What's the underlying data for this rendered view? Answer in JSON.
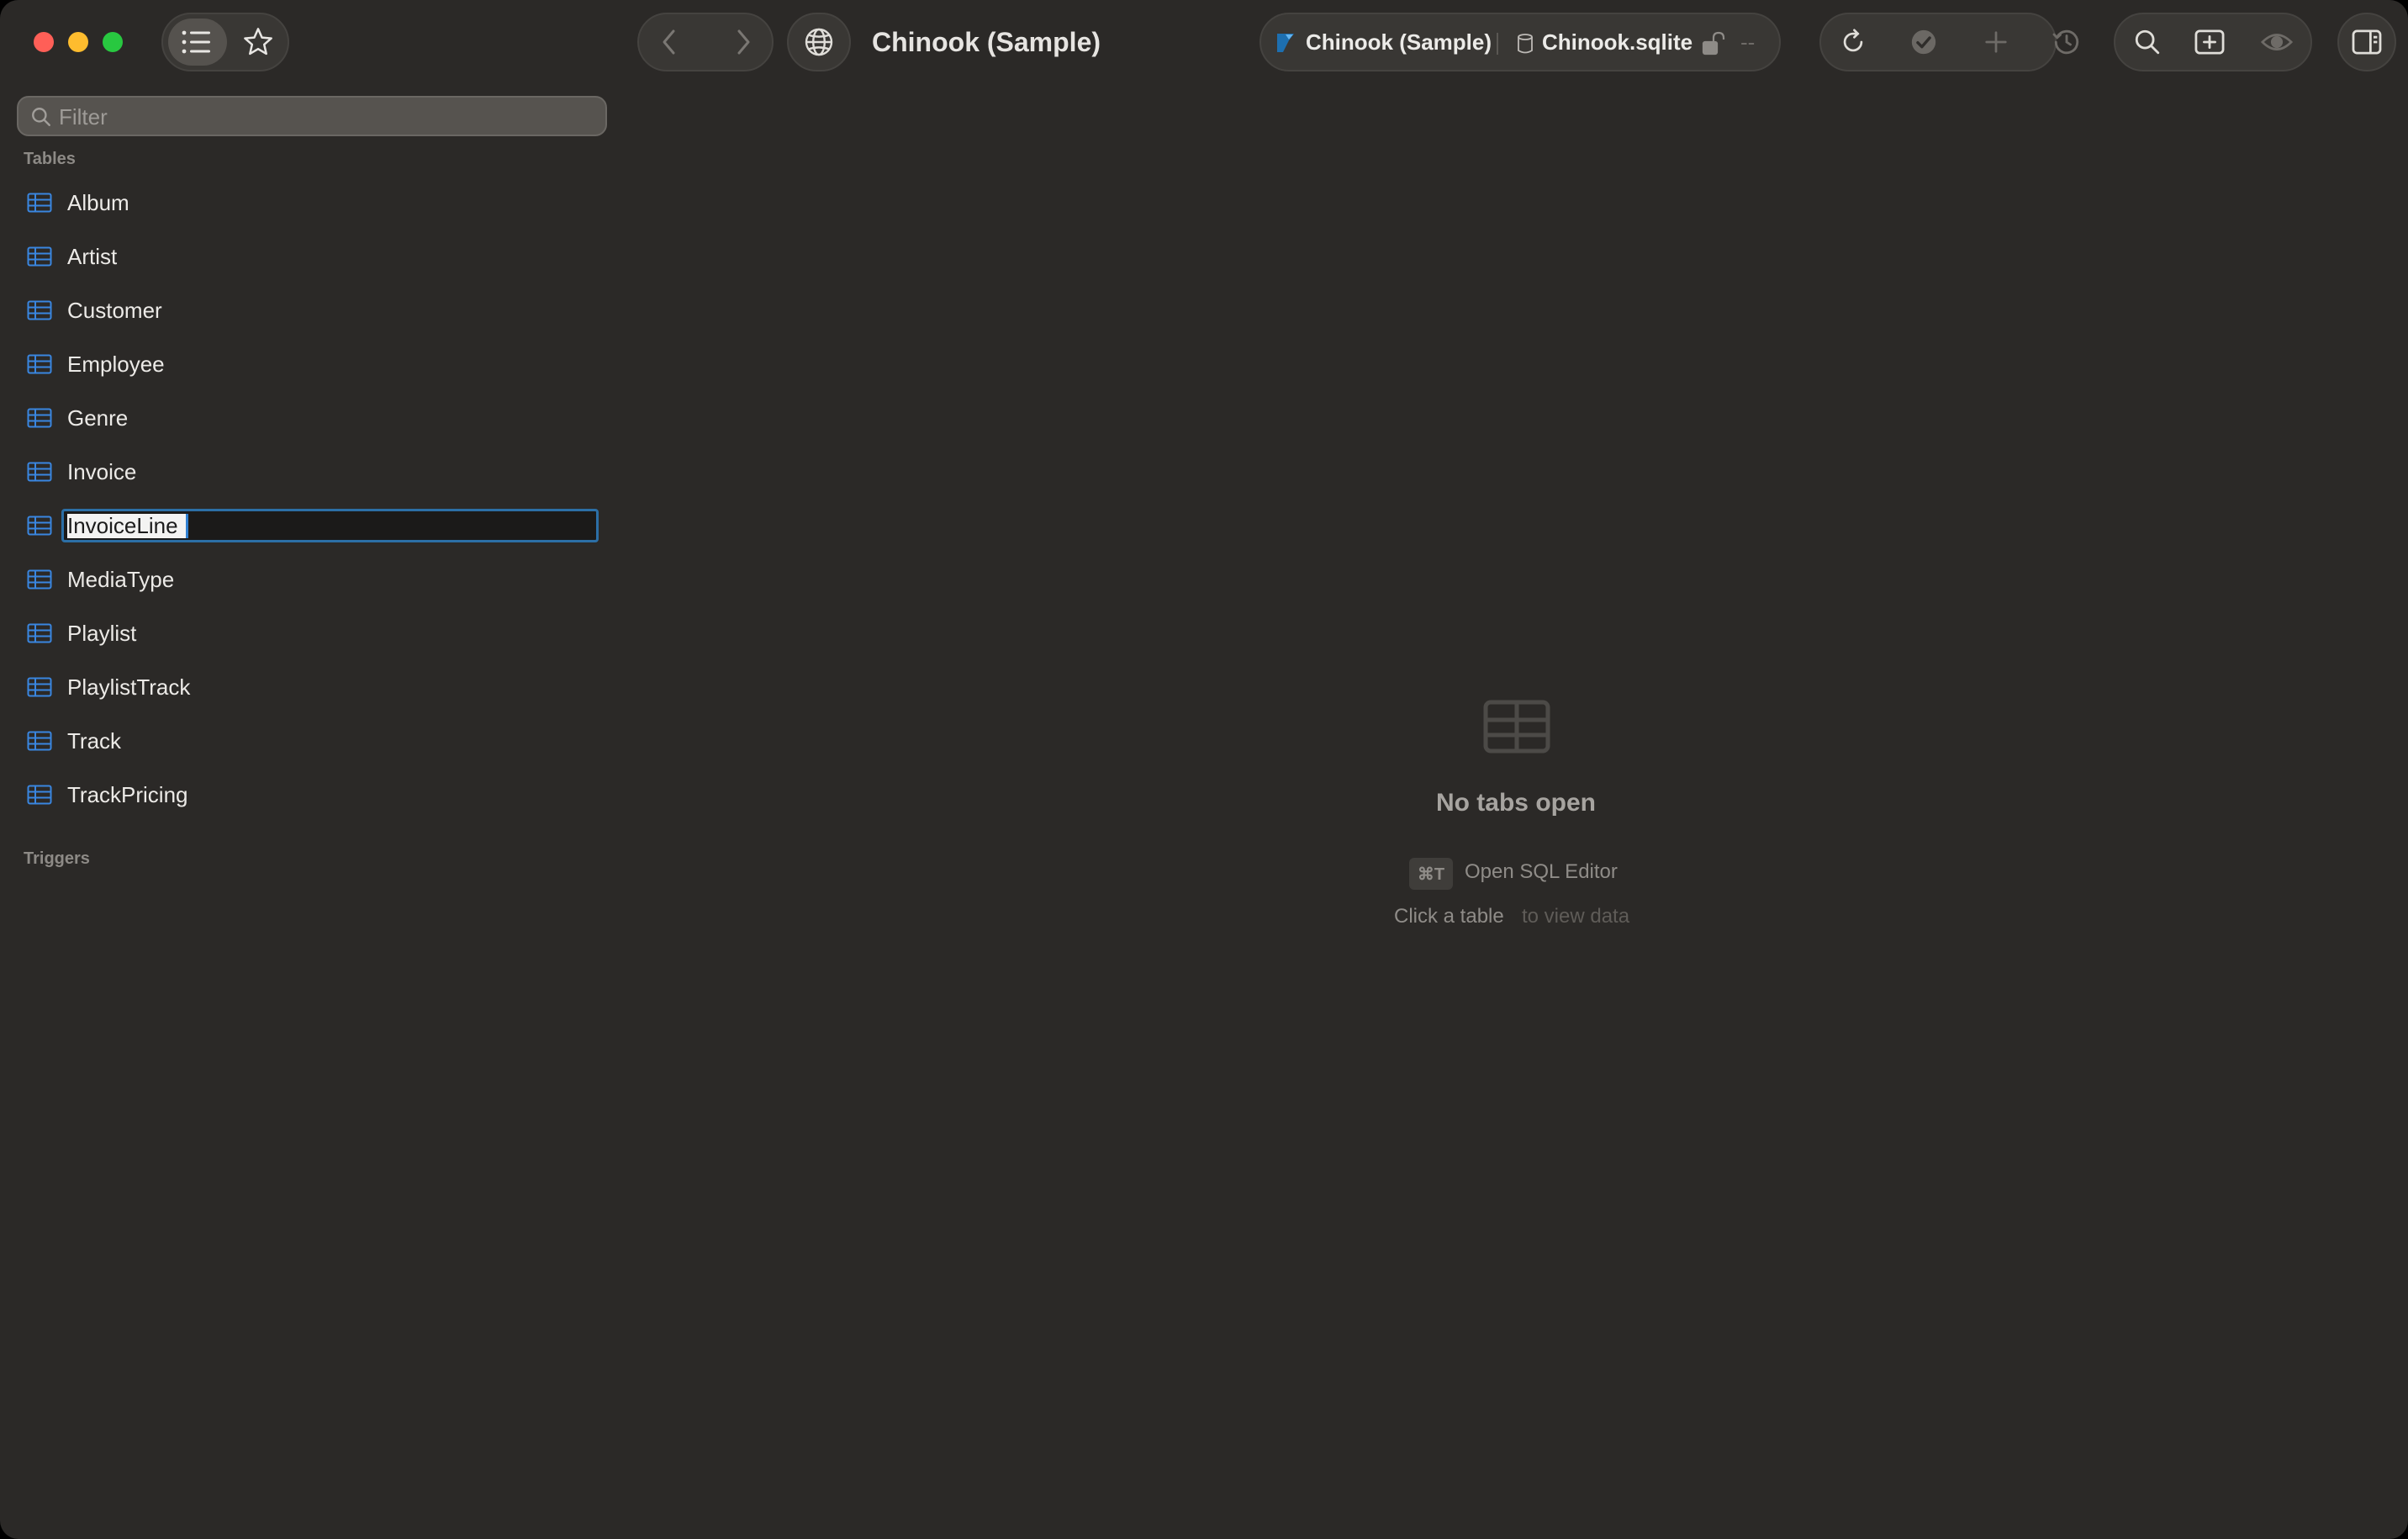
{
  "window": {
    "title": "Chinook (Sample)"
  },
  "toolbar": {
    "connection_name": "Chinook (Sample)",
    "database_file": "Chinook.sqlite",
    "status_dash": "--"
  },
  "sidebar": {
    "filter_placeholder": "Filter",
    "tables_header": "Tables",
    "tables": [
      {
        "label": "Album"
      },
      {
        "label": "Artist"
      },
      {
        "label": "Customer"
      },
      {
        "label": "Employee"
      },
      {
        "label": "Genre"
      },
      {
        "label": "Invoice"
      },
      {
        "label": "InvoiceLine",
        "editing": true
      },
      {
        "label": "MediaType"
      },
      {
        "label": "Playlist"
      },
      {
        "label": "PlaylistTrack"
      },
      {
        "label": "Track"
      },
      {
        "label": "TrackPricing"
      }
    ],
    "triggers_header": "Triggers"
  },
  "empty_state": {
    "title": "No tabs open",
    "shortcut_key": "⌘T",
    "shortcut_action": "Open SQL Editor",
    "click_hint_bold": "Click a table",
    "click_hint_rest": "to view data"
  },
  "colors": {
    "accent": "#2f7fd0",
    "table_icon": "#3a86e0",
    "background": "#2b2927"
  },
  "icons": [
    "list-icon",
    "star-icon",
    "chevron-left-icon",
    "chevron-right-icon",
    "globe-icon",
    "sqlite-connection-icon",
    "database-icon",
    "unlock-icon",
    "refresh-icon",
    "check-circle-icon",
    "plus-icon",
    "history-icon",
    "search-icon",
    "new-tab-icon",
    "eye-icon",
    "sidebar-right-icon",
    "table-icon"
  ]
}
